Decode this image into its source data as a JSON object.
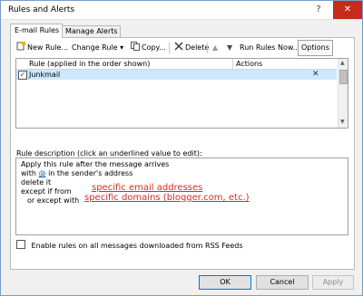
{
  "window": {
    "title": "Rules and Alerts",
    "help": "?",
    "close": "✕"
  },
  "tabs": [
    {
      "label": "E-mail Rules"
    },
    {
      "label": "Manage Alerts"
    }
  ],
  "toolbar": {
    "new_rule": "New Rule...",
    "change_rule": "Change Rule",
    "copy": "Copy...",
    "delete": "Delete",
    "up": "▲",
    "down": "▼",
    "run_rules": "Run Rules Now...",
    "options": "Options"
  },
  "rules_list": {
    "col_rule": "Rule (applied in the order shown)",
    "col_actions": "Actions",
    "rows": [
      {
        "name": "Junkmail",
        "checked": true
      }
    ]
  },
  "description": {
    "label": "Rule description (click an underlined value to edit):",
    "lines": [
      "Apply this rule after the message arrives",
      "with",
      "in the sender's address",
      "delete it",
      "except if from",
      "or except with"
    ],
    "at_link": "@",
    "annotation_1": "specific email addresses",
    "annotation_2": "specific domains (blogger.com, etc.)"
  },
  "rss": {
    "label": "Enable rules on all messages downloaded from RSS Feeds",
    "checked": false
  },
  "buttons": {
    "ok": "OK",
    "cancel": "Cancel",
    "apply": "Apply"
  },
  "colors": {
    "selection": "#cce8ff",
    "annotation": "#d92a2a",
    "accent": "#0078d7"
  }
}
